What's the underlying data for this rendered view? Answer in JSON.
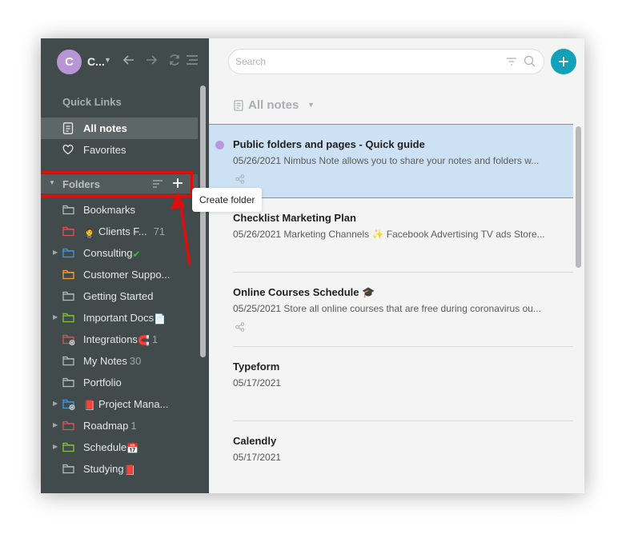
{
  "account": {
    "avatar_letter": "C",
    "name_truncated": "C...",
    "avatar_color": "#b796d6"
  },
  "nav": {
    "back_icon": "arrow-left-icon",
    "forward_icon": "arrow-right-icon",
    "sync_icon": "sync-icon",
    "menu_icon": "menu-icon"
  },
  "quick_links": {
    "title": "Quick Links",
    "items": [
      {
        "label": "All notes",
        "icon": "notes-icon",
        "active": true
      },
      {
        "label": "Favorites",
        "icon": "heart-icon",
        "active": false
      }
    ]
  },
  "folders": {
    "title": "Folders",
    "sort_icon": "sort-icon",
    "add_icon": "plus-icon",
    "items": [
      {
        "label": "Bookmarks",
        "emoji": "",
        "count": "",
        "color": "#b3bcbc",
        "expandable": false,
        "shared": false
      },
      {
        "label": "Clients F...",
        "emoji_before": "🤵",
        "count": "71",
        "color": "#e24f4f",
        "expandable": false,
        "shared": false
      },
      {
        "label": "Consulting",
        "emoji": "✔",
        "count": "",
        "color": "#3d98e6",
        "expandable": true,
        "shared": false
      },
      {
        "label": "Customer Suppo...",
        "emoji": "",
        "count": "",
        "color": "#f2a13a",
        "expandable": false,
        "shared": false
      },
      {
        "label": "Getting Started",
        "emoji": "",
        "count": "",
        "color": "#b3bcbc",
        "expandable": false,
        "shared": false
      },
      {
        "label": "Important Docs",
        "emoji": "📄",
        "count": "",
        "color": "#82c341",
        "expandable": true,
        "shared": false
      },
      {
        "label": "Integrations",
        "emoji": "🧲",
        "count": "1",
        "color": "#e24f4f",
        "expandable": false,
        "shared": true
      },
      {
        "label": "My Notes",
        "emoji": "",
        "count": "30",
        "color": "#b3bcbc",
        "expandable": false,
        "shared": false
      },
      {
        "label": "Portfolio",
        "emoji": "",
        "count": "",
        "color": "#b3bcbc",
        "expandable": false,
        "shared": false
      },
      {
        "label": "Project Mana...",
        "emoji_before": "📕",
        "count": "",
        "color": "#3d98e6",
        "expandable": true,
        "shared": true
      },
      {
        "label": "Roadmap",
        "emoji": "",
        "count": "1",
        "color": "#e24f4f",
        "expandable": true,
        "shared": false
      },
      {
        "label": "Schedule",
        "emoji": "📅",
        "count": "",
        "color": "#82c341",
        "expandable": true,
        "shared": false
      },
      {
        "label": "Studying",
        "emoji": "📕",
        "count": "",
        "color": "#b3bcbc",
        "expandable": false,
        "shared": false
      }
    ]
  },
  "tooltip": {
    "text": "Create folder"
  },
  "search": {
    "placeholder": "Search",
    "value": ""
  },
  "add_note_color": "#11a1b8",
  "list": {
    "title": "All notes",
    "notes": [
      {
        "title": "Public folders and pages - Quick guide",
        "date": "05/26/2021",
        "preview": "Nimbus Note allows you to share your notes and folders w...",
        "shared": true,
        "selected": true,
        "dot": true
      },
      {
        "title": "Checklist Marketing Plan",
        "date": "05/26/2021",
        "preview": "Marketing Channels ✨ Facebook Advertising TV ads Store...",
        "shared": false,
        "selected": false,
        "dot": false
      },
      {
        "title": "Online Courses Schedule 🎓",
        "date": "05/25/2021",
        "preview": "Store all online courses that are free during coronavirus ou...",
        "shared": true,
        "selected": false,
        "dot": false
      },
      {
        "title": "Typeform",
        "date": "05/17/2021",
        "preview": "",
        "shared": false,
        "selected": false,
        "dot": false
      },
      {
        "title": "Calendly",
        "date": "05/17/2021",
        "preview": "",
        "shared": false,
        "selected": false,
        "dot": false
      }
    ]
  },
  "annotation_color": "#e00d0d"
}
